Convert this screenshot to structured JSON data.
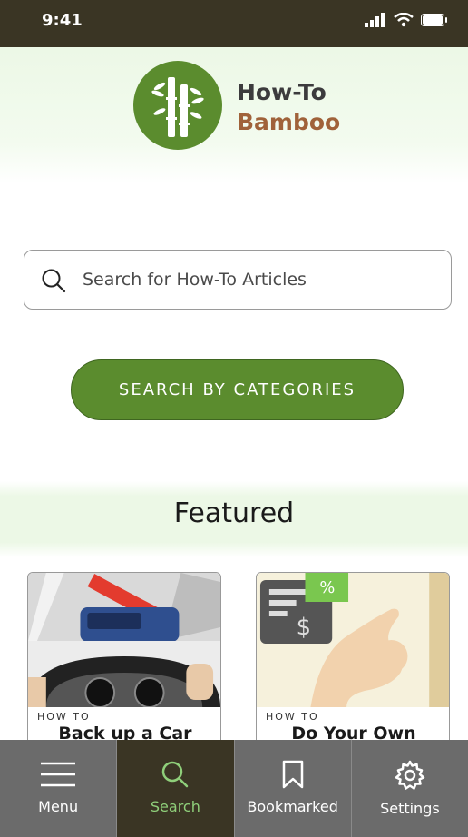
{
  "status": {
    "time": "9:41"
  },
  "brand": {
    "line1": "How-To",
    "line2": "Bamboo"
  },
  "search": {
    "placeholder": "Search for How-To Articles"
  },
  "categories_button": {
    "label": "SEARCH BY CATEGORIES"
  },
  "featured": {
    "title": "Featured",
    "cards": [
      {
        "kicker": "HOW TO",
        "title": "Back up a Car"
      },
      {
        "kicker": "HOW TO",
        "title": "Do Your Own Taxes"
      }
    ]
  },
  "nav": {
    "items": [
      {
        "label": "Menu",
        "icon": "menu-icon"
      },
      {
        "label": "Search",
        "icon": "search-icon"
      },
      {
        "label": "Bookmarked",
        "icon": "bookmark-icon"
      },
      {
        "label": "Settings",
        "icon": "gear-icon"
      }
    ],
    "active": "Search"
  },
  "colors": {
    "brand_green": "#5b8c2e",
    "brand_brown": "#a0623a",
    "dark_bar": "#3a3524",
    "nav_gray": "#6b6b6b",
    "active_icon": "#8fcf7a"
  }
}
